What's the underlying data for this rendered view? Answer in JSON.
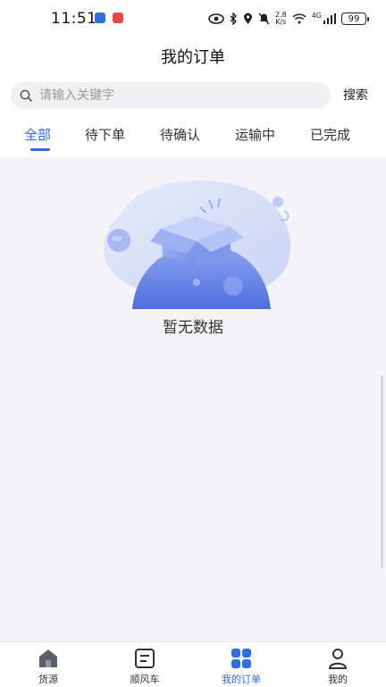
{
  "status_bar": {
    "time": "11:51",
    "net_speed_value": "2.8",
    "net_speed_unit": "K/s",
    "network": "4G",
    "battery": "99"
  },
  "header": {
    "title": "我的订单"
  },
  "search": {
    "placeholder": "请输入关键字",
    "button_label": "搜索"
  },
  "tabs": [
    {
      "label": "全部",
      "active": true
    },
    {
      "label": "待下单",
      "active": false
    },
    {
      "label": "待确认",
      "active": false
    },
    {
      "label": "运输中",
      "active": false
    },
    {
      "label": "已完成",
      "active": false
    }
  ],
  "empty_state": {
    "text": "暂无数据",
    "icon": "empty-box-illustration"
  },
  "bottom_nav": [
    {
      "label": "货源",
      "icon": "home-icon",
      "active": false
    },
    {
      "label": "顺风车",
      "icon": "list-icon",
      "active": false
    },
    {
      "label": "我的订单",
      "icon": "grid-icon",
      "active": true
    },
    {
      "label": "我的",
      "icon": "user-icon",
      "active": false
    }
  ],
  "colors": {
    "accent": "#2f6de0",
    "background": "#f4f4f6"
  }
}
